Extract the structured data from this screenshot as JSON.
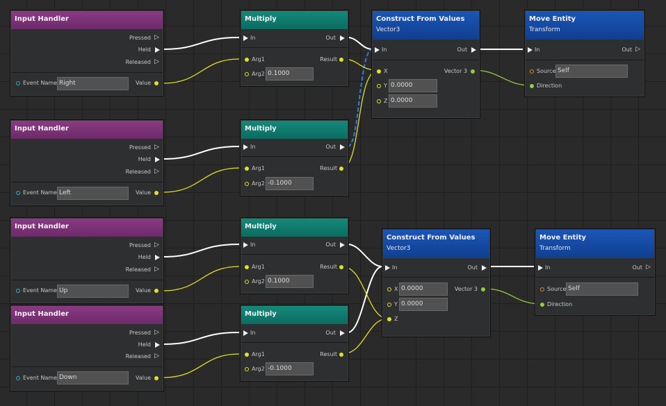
{
  "colors": {
    "input_handler_header": "#7d3378",
    "multiply_header": "#0f7c6e",
    "construct_header": "#1649a2",
    "exec_wire": "#ffffff",
    "float_wire": "#e2e21c",
    "vector_wire": "#8fcf3c",
    "selected_wire": "#3a7be0"
  },
  "icons": {
    "exec_pin": "triangle-right",
    "exec_pin_empty": "triangle-right-outline",
    "data_pin": "circle",
    "data_pin_empty": "circle-outline"
  },
  "input_handlers": [
    {
      "title": "Input Handler",
      "pressed": "Pressed",
      "held": "Held",
      "released": "Released",
      "event_label": "Event Name",
      "event_value": "Right",
      "value_label": "Value"
    },
    {
      "title": "Input Handler",
      "pressed": "Pressed",
      "held": "Held",
      "released": "Released",
      "event_label": "Event Name",
      "event_value": "Left",
      "value_label": "Value"
    },
    {
      "title": "Input Handler",
      "pressed": "Pressed",
      "held": "Held",
      "released": "Released",
      "event_label": "Event Name",
      "event_value": "Up",
      "value_label": "Value"
    },
    {
      "title": "Input Handler",
      "pressed": "Pressed",
      "held": "Held",
      "released": "Released",
      "event_label": "Event Name",
      "event_value": "Down",
      "value_label": "Value"
    }
  ],
  "multiplies": [
    {
      "title": "Multiply",
      "in": "In",
      "out": "Out",
      "arg1": "Arg1",
      "result": "Result",
      "arg2": "Arg2",
      "arg2_value": "0.1000"
    },
    {
      "title": "Multiply",
      "in": "In",
      "out": "Out",
      "arg1": "Arg1",
      "result": "Result",
      "arg2": "Arg2",
      "arg2_value": "-0.1000"
    },
    {
      "title": "Multiply",
      "in": "In",
      "out": "Out",
      "arg1": "Arg1",
      "result": "Result",
      "arg2": "Arg2",
      "arg2_value": "0.1000"
    },
    {
      "title": "Multiply",
      "in": "In",
      "out": "Out",
      "arg1": "Arg1",
      "result": "Result",
      "arg2": "Arg2",
      "arg2_value": "-0.1000"
    }
  ],
  "constructs": [
    {
      "title": "Construct From Values",
      "subtitle": "Vector3",
      "in": "In",
      "out": "Out",
      "x_label": "X",
      "y_label": "Y",
      "y_value": "0.0000",
      "z_label": "Z",
      "z_value": "0.0000",
      "vector_label": "Vector 3"
    },
    {
      "title": "Construct From Values",
      "subtitle": "Vector3",
      "in": "In",
      "out": "Out",
      "x_label": "X",
      "x_value": "0.0000",
      "y_label": "Y",
      "y_value": "0.0000",
      "z_label": "Z",
      "vector_label": "Vector 3"
    }
  ],
  "move_entities": [
    {
      "title": "Move Entity",
      "subtitle": "Transform",
      "in": "In",
      "out": "Out",
      "source_label": "Source",
      "source_value": "Self",
      "direction_label": "Direction"
    },
    {
      "title": "Move Entity",
      "subtitle": "Transform",
      "in": "In",
      "out": "Out",
      "source_label": "Source",
      "source_value": "Self",
      "direction_label": "Direction"
    }
  ]
}
